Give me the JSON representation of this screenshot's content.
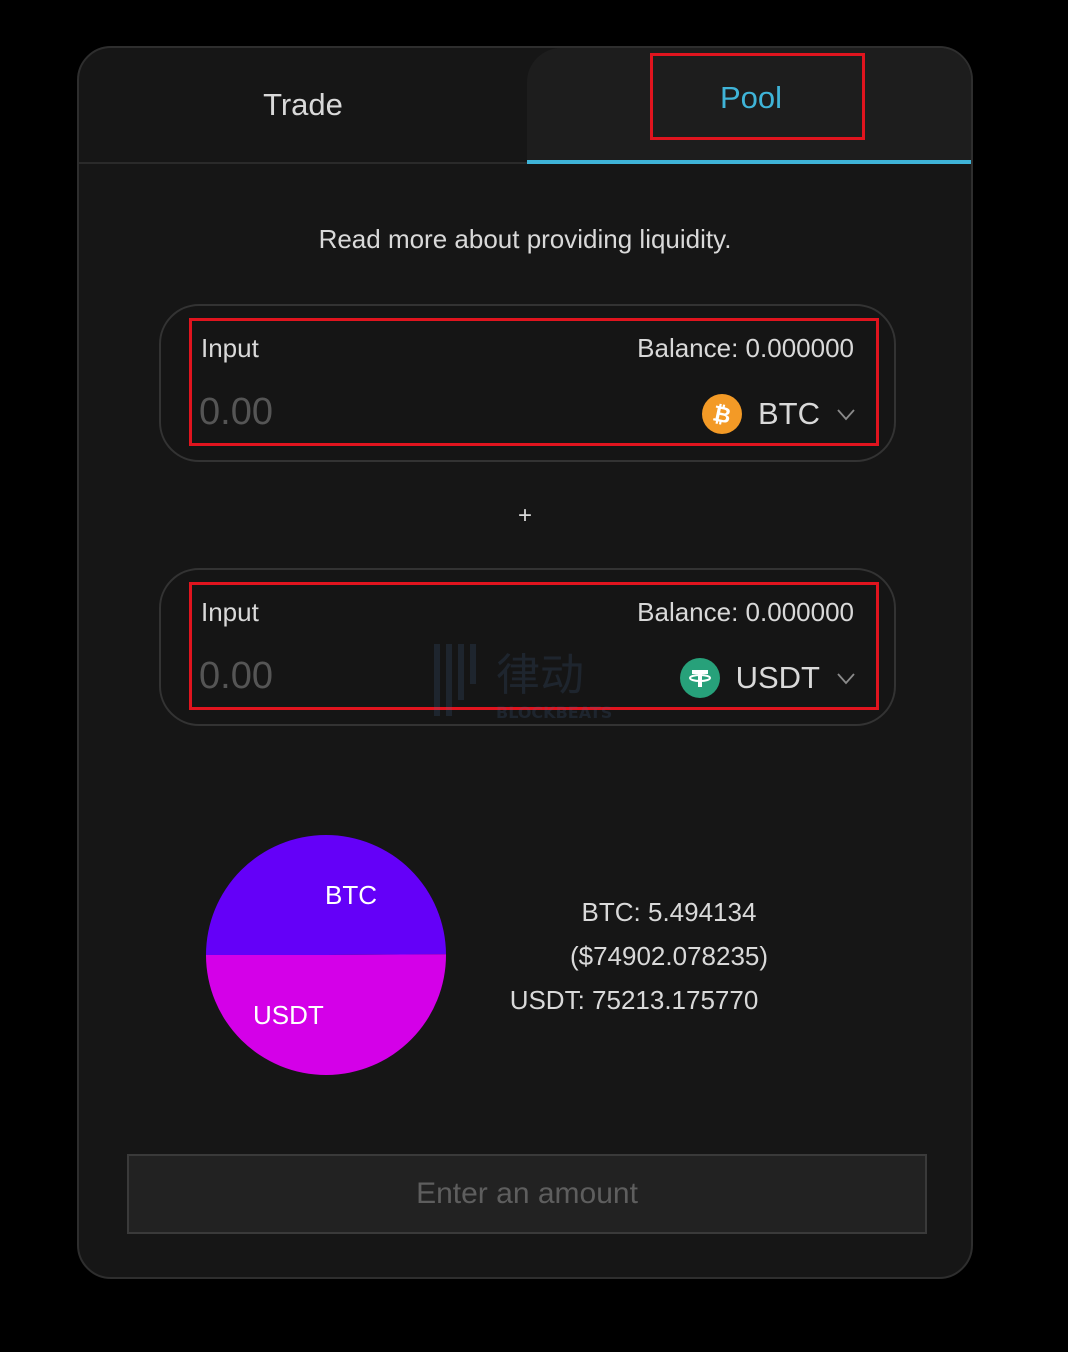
{
  "tabs": {
    "trade_label": "Trade",
    "pool_label": "Pool",
    "active": "pool"
  },
  "info_link": "Read more about providing liquidity.",
  "inputs": [
    {
      "label": "Input",
      "balance": "Balance: 0.000000",
      "placeholder": "0.00",
      "token": "BTC",
      "token_icon": "bitcoin-icon",
      "token_icon_color": "#f39a26"
    },
    {
      "label": "Input",
      "balance": "Balance: 0.000000",
      "placeholder": "0.00",
      "token": "USDT",
      "token_icon": "tether-icon",
      "token_icon_color": "#27a17a"
    }
  ],
  "plus_sign": "+",
  "watermark": {
    "text": "律动",
    "subtext": "BLOCKBEATS"
  },
  "pool_stats": {
    "btc_line": "BTC: 5.494134",
    "btc_usd_line": "($74902.078235)",
    "usdt_line": "USDT: 75213.175770"
  },
  "chart_data": {
    "type": "pie",
    "categories": [
      "BTC",
      "USDT"
    ],
    "values": [
      74902.078235,
      75213.17577
    ],
    "colors": [
      "#6400f8",
      "#d400e8"
    ]
  },
  "submit_label": "Enter an amount",
  "colors": {
    "accent": "#3fb4d8",
    "highlight": "#e0141e",
    "background": "#161616"
  }
}
